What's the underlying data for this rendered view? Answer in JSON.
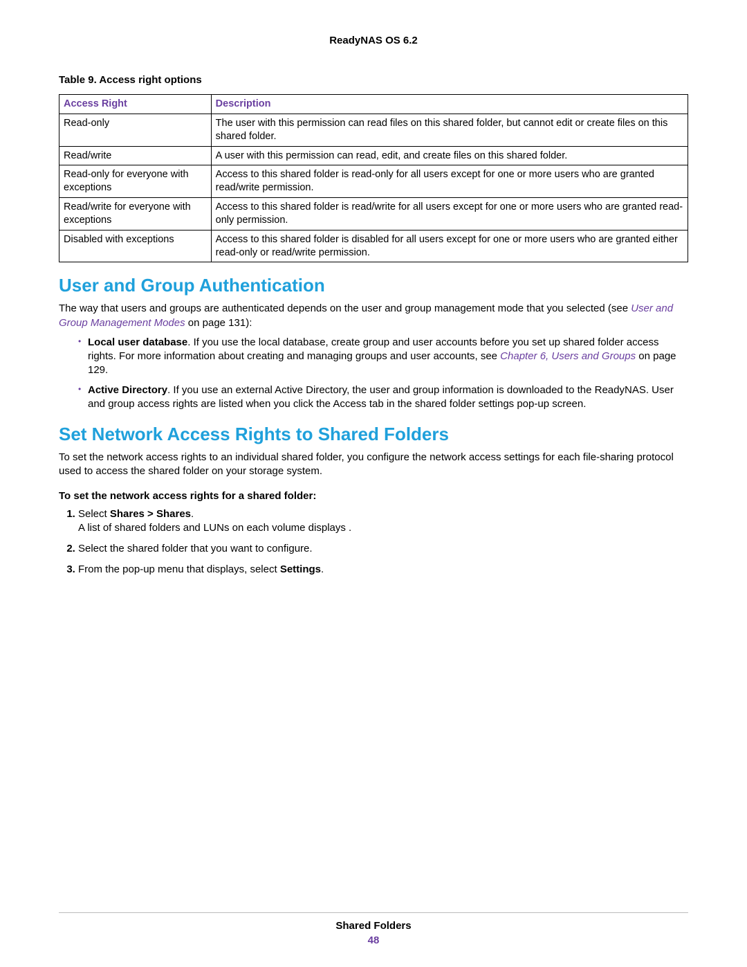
{
  "header": {
    "title": "ReadyNAS OS 6.2"
  },
  "table": {
    "caption": "Table 9. Access right options",
    "headers": [
      "Access Right",
      "Description"
    ],
    "rows": [
      {
        "right": "Read-only",
        "desc": "The user with this permission can read files on this shared folder, but cannot edit or create files on this shared folder."
      },
      {
        "right": "Read/write",
        "desc": "A user with this permission can read, edit, and create files on this shared folder."
      },
      {
        "right": "Read-only for everyone with exceptions",
        "desc": "Access to this shared folder is read-only for all users except for one or more users who are granted read/write permission."
      },
      {
        "right": "Read/write for everyone with exceptions",
        "desc": "Access to this shared folder is read/write for all users except for one or more users who are granted read-only permission."
      },
      {
        "right": "Disabled with exceptions",
        "desc": "Access to this shared folder is disabled for all users except for one or more users who are granted either read-only or read/write permission."
      }
    ]
  },
  "section1": {
    "heading": "User and Group Authentication",
    "intro_pre": "The way that users and groups are authenticated depends on the user and group management mode that you selected (see ",
    "intro_link": "User and Group Management Modes",
    "intro_post": " on page 131):",
    "bullets": [
      {
        "lead": "Local user database",
        "text_pre": ". If you use the local database, create group and user accounts before you set up shared folder access rights. For more information about creating and managing groups and user accounts, see ",
        "link": "Chapter 6, Users and Groups",
        "text_post": " on page 129."
      },
      {
        "lead": "Active Directory",
        "text_pre": ". If you use an external Active Directory, the user and group information is downloaded to the ReadyNAS. User and group access rights are listed when you click the Access tab in the shared folder settings pop-up screen.",
        "link": "",
        "text_post": ""
      }
    ]
  },
  "section2": {
    "heading": "Set Network Access Rights to Shared Folders",
    "intro": "To set the network access rights to an individual shared folder, you configure the network access settings for each file-sharing protocol used to access the shared folder on your storage system.",
    "procedure_title": "To set the network access rights for a shared folder:",
    "steps": [
      {
        "pre": "Select ",
        "bold": "Shares > Shares",
        "post": ".",
        "sub": "A list of shared folders and LUNs on each volume displays ."
      },
      {
        "pre": "Select the shared folder that you want to configure.",
        "bold": "",
        "post": "",
        "sub": ""
      },
      {
        "pre": "From the pop-up menu that displays, select ",
        "bold": "Settings",
        "post": ".",
        "sub": ""
      }
    ]
  },
  "footer": {
    "section": "Shared Folders",
    "page": "48"
  }
}
